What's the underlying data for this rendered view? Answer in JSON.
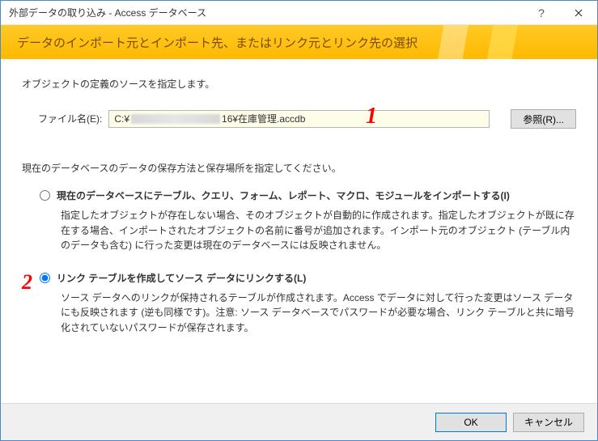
{
  "titlebar": {
    "title": "外部データの取り込み - Access データベース"
  },
  "banner": {
    "title": "データのインポート元とインポート先、またはリンク元とリンク先の選択"
  },
  "section_label": "オブジェクトの定義のソースを指定します。",
  "file": {
    "label": "ファイル名(E):",
    "prefix": "C:¥",
    "suffix": "16¥在庫管理.accdb",
    "browse": "参照(R)..."
  },
  "instruction": "現在のデータベースのデータの保存方法と保存場所を指定してください。",
  "options": [
    {
      "label": "現在のデータベースにテーブル、クエリ、フォーム、レポート、マクロ、モジュールをインポートする(I)",
      "desc": "指定したオブジェクトが存在しない場合、そのオブジェクトが自動的に作成されます。指定したオブジェクトが既に存在する場合、インポートされたオブジェクトの名前に番号が追加されます。インポート元のオブジェクト (テーブル内のデータも含む) に行った変更は現在のデータベースには反映されません。",
      "selected": false
    },
    {
      "label": "リンク テーブルを作成してソース データにリンクする(L)",
      "desc": "ソース データへのリンクが保持されるテーブルが作成されます。Access でデータに対して行った変更はソース データにも反映されます (逆も同様です)。注意: ソース データベースでパスワードが必要な場合、リンク テーブルと共に暗号化されていないパスワードが保存されます。",
      "selected": true
    }
  ],
  "annotations": {
    "one": "1",
    "two": "2"
  },
  "footer": {
    "ok": "OK",
    "cancel": "キャンセル"
  }
}
